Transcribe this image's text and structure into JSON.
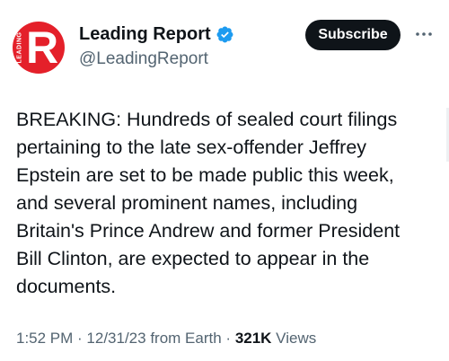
{
  "author": {
    "display_name": "Leading Report",
    "handle": "@LeadingReport",
    "avatar": {
      "letter": "R",
      "side_text": "LEADING",
      "color": "#e4202a"
    },
    "verified_icon": "verified-badge-icon",
    "verified_color": "#1d9bf0"
  },
  "actions": {
    "subscribe_label": "Subscribe",
    "more_icon": "more-dots-icon"
  },
  "tweet": {
    "text": "BREAKING: Hundreds of sealed court filings\npertaining to the late sex-offender Jeffrey\nEpstein are set to be made public this week,\nand several prominent names, including\nBritain's Prince Andrew and former President\nBill Clinton, are expected to appear in the\ndocuments."
  },
  "meta": {
    "time": "1:52 PM",
    "sep1": " · ",
    "date": "12/31/23",
    "source": " from Earth",
    "sep2": " · ",
    "views_count": "321K",
    "views_label": " Views"
  }
}
